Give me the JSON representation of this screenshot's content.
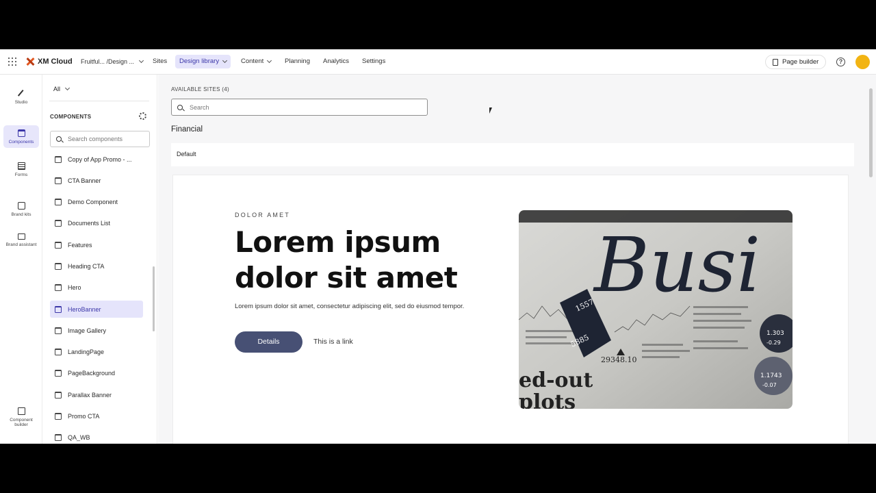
{
  "topbar": {
    "app_name": "XM Cloud",
    "org_path": "Fruitful... /Design ...",
    "nav": [
      "Sites",
      "Design library",
      "Content",
      "Planning",
      "Analytics",
      "Settings"
    ],
    "page_builder_label": "Page builder",
    "help_label": "?"
  },
  "rail": {
    "items": [
      {
        "label": "Studio"
      },
      {
        "label": "Components"
      },
      {
        "label": "Forms"
      },
      {
        "label": "Brand kits"
      },
      {
        "label": "Brand assistant"
      },
      {
        "label": "Component builder"
      }
    ]
  },
  "panel": {
    "filter_label": "All",
    "components_title": "COMPONENTS",
    "search_placeholder": "Search components",
    "items": [
      "Copy of App Promo - ...",
      "CTA Banner",
      "Demo Component",
      "Documents List",
      "Features",
      "Heading CTA",
      "Hero",
      "HeroBanner",
      "Image Gallery",
      "LandingPage",
      "PageBackground",
      "Parallax Banner",
      "Promo CTA",
      "QA_WB"
    ],
    "selected_item": "HeroBanner"
  },
  "main": {
    "sites_label": "AVAILABLE SITES (4)",
    "search_placeholder": "Search",
    "section_title": "Financial",
    "variant_label": "Default",
    "preview": {
      "eyebrow": "DOLOR AMET",
      "headline": "Lorem ipsum dolor sit amet",
      "body": "Lorem ipsum dolor sit amet, consectetur adipiscing elit, sed do eiusmod tempor.",
      "button_label": "Details",
      "link_label": "This is a link",
      "image_text": {
        "masthead": "Busi",
        "sub1": "ed-out",
        "sub2": "plots",
        "price1": "1557",
        "price2": "5885",
        "index": "29348.10",
        "coin1_rate": "1.303",
        "coin1_change": "-0.29",
        "coin2_rate": "1.1743",
        "coin2_change": "-0.07"
      }
    }
  },
  "colors": {
    "accent": "#3b36a8",
    "accent_bg": "#e5e4fb",
    "button": "#475074",
    "avatar": "#f2b413",
    "logo": "#e2561f"
  }
}
